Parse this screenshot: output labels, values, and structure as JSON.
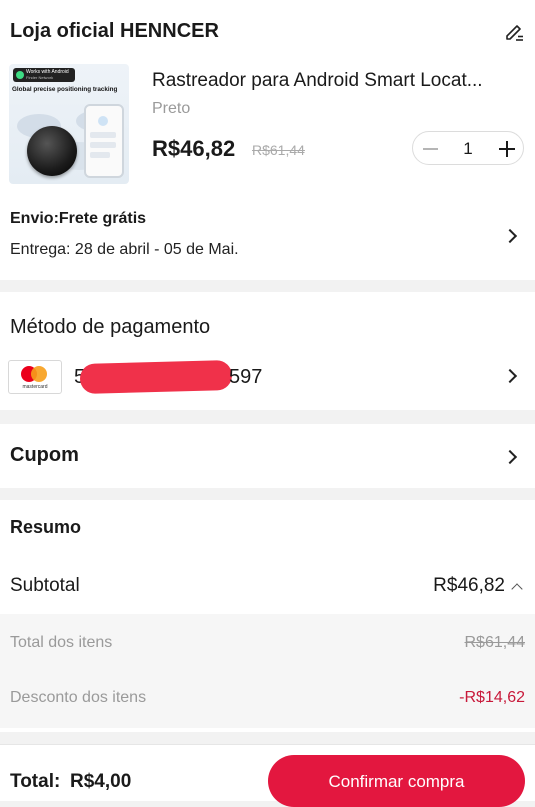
{
  "store": {
    "name": "Loja oficial HENNCER"
  },
  "product": {
    "image_line1": "Works with Android",
    "image_line2": "Finder Network",
    "image_headline": "Global precise positioning tracking",
    "title": "Rastreador para Android Smart Locat...",
    "variant": "Preto",
    "price": "R$46,82",
    "original_price": "R$61,44",
    "quantity": "1"
  },
  "shipping": {
    "title": "Envio:Frete grátis",
    "delivery": "Entrega: 28 de abril - 05 de Mai."
  },
  "payment": {
    "title": "Método de pagamento",
    "card_brand_label": "mastercard",
    "card_prefix": "520",
    "card_suffix": "597"
  },
  "coupon": {
    "label": "Cupom"
  },
  "summary": {
    "title": "Resumo",
    "subtotal_label": "Subtotal",
    "subtotal_value": "R$46,82",
    "items_total_label": "Total dos itens",
    "items_total_value": "R$61,44",
    "discount_label": "Desconto dos itens",
    "discount_value": "-R$14,62"
  },
  "footer": {
    "total_label": "Total:",
    "total_value": "R$4,00",
    "confirm_label": "Confirmar compra"
  },
  "colors": {
    "accent": "#e3173f",
    "discount": "#c8193a",
    "mastercard_red": "#eb001b",
    "mastercard_orange": "#f79e1b",
    "redact": "#f0314a"
  }
}
